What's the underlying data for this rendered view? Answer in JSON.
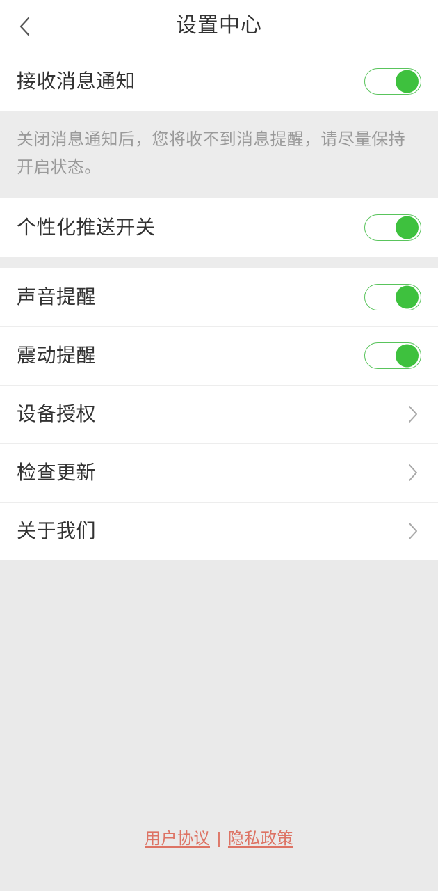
{
  "header": {
    "title": "设置中心",
    "back_icon": "chevron-left-icon"
  },
  "colors": {
    "page_background": "#eaeaea",
    "card_background": "#ffffff",
    "divider": "#ededed",
    "primary_text": "#333333",
    "hint_text": "#9a9a9a",
    "toggle_on_track_border": "#59c45c",
    "toggle_on_knob": "#3ec13e",
    "chevron": "#a8a8a8",
    "link": "#dd7364"
  },
  "sections": [
    {
      "rows": [
        {
          "label": "接收消息通知",
          "type": "toggle",
          "state": "on"
        }
      ]
    }
  ],
  "hint": {
    "text": "关闭消息通知后，您将收不到消息提醒，请尽量保持开启状态。"
  },
  "section_push": {
    "rows": [
      {
        "label": "个性化推送开关",
        "type": "toggle",
        "state": "on"
      }
    ]
  },
  "section_alerts": {
    "rows": [
      {
        "label": "声音提醒",
        "type": "toggle",
        "state": "on"
      },
      {
        "label": "震动提醒",
        "type": "toggle",
        "state": "on"
      },
      {
        "label": "设备授权",
        "type": "nav",
        "icon": "chevron-right-icon"
      },
      {
        "label": "检查更新",
        "type": "nav",
        "icon": "chevron-right-icon"
      },
      {
        "label": "关于我们",
        "type": "nav",
        "icon": "chevron-right-icon"
      }
    ]
  },
  "footer": {
    "user_agreement": "用户协议",
    "separator": "|",
    "privacy_policy": "隐私政策"
  }
}
